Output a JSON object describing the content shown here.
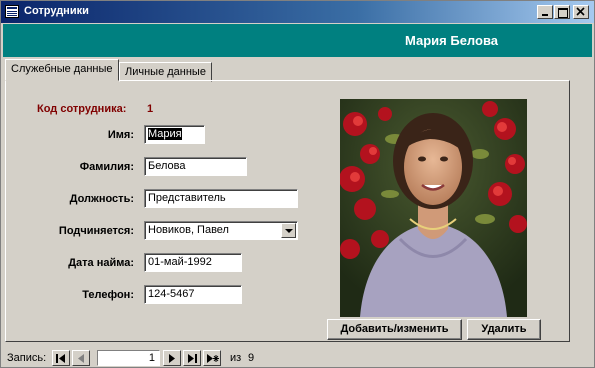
{
  "window": {
    "title": "Сотрудники"
  },
  "header": {
    "employee_name": "Мария Белова"
  },
  "tabs": [
    {
      "label": "Служебные данные",
      "active": true
    },
    {
      "label": "Личные данные",
      "active": false
    }
  ],
  "form": {
    "id": {
      "label": "Код сотрудника:",
      "value": "1"
    },
    "first_name": {
      "label": "Имя:",
      "value": "Мария"
    },
    "last_name": {
      "label": "Фамилия:",
      "value": "Белова"
    },
    "position": {
      "label": "Должность:",
      "value": "Представитель"
    },
    "reports_to": {
      "label": "Подчиняется:",
      "value": "Новиков, Павел"
    },
    "hire_date": {
      "label": "Дата найма:",
      "value": "01-май-1992"
    },
    "phone": {
      "label": "Телефон:",
      "value": "124-5467"
    }
  },
  "buttons": {
    "edit_photo": "Добавить/изменить",
    "delete_photo": "Удалить"
  },
  "record_nav": {
    "label": "Запись:",
    "current": "1",
    "of_label": "из",
    "total": "9"
  },
  "colors": {
    "header_band": "#008080",
    "title_bar": "#0a246a",
    "id_label": "#800000"
  },
  "icons": [
    "window-icon",
    "minimize-icon",
    "maximize-icon",
    "close-icon",
    "dropdown-arrow-icon",
    "first-record-icon",
    "prev-record-icon",
    "next-record-icon",
    "last-record-icon",
    "new-record-icon"
  ]
}
